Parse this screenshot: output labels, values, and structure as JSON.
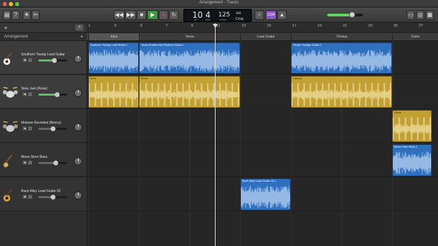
{
  "window": {
    "title": "Arrangement - Tracks"
  },
  "toolbar": {
    "lcd": {
      "bar": "10",
      "beat": "4",
      "bar_label": "bar",
      "beat_label": "beat",
      "tempo": "125",
      "tempo_label": "tempo",
      "sig": "4/4",
      "key": "Cmaj"
    },
    "count_in_label": "1234",
    "master_volume": 0.7
  },
  "arrangement_header": {
    "label": "Arrangement",
    "add": "+"
  },
  "ruler": {
    "bars": [
      "1",
      "3",
      "5",
      "7",
      "9",
      "11",
      "13",
      "15",
      "17",
      "19",
      "21",
      "23",
      "25",
      "27"
    ]
  },
  "sections": [
    {
      "label": "Intro"
    },
    {
      "label": "Verse"
    },
    {
      "label": "Lead Guitar"
    },
    {
      "label": "Chorus"
    },
    {
      "label": "Outro"
    }
  ],
  "tracks": [
    {
      "name": "Southern Twang Lead Guitar",
      "volume": 0.55
    },
    {
      "name": "Slow Jam (Rose)",
      "volume": 0.65
    },
    {
      "name": "Motown Revisited (Benny)",
      "volume": 0.5
    },
    {
      "name": "Blues Siren Bass",
      "volume": 0.6
    },
    {
      "name": "Back Alley Lead Guitar 02",
      "volume": 0.5
    }
  ],
  "regions": [
    {
      "label": "Southern Twang Lead Guitar.1"
    },
    {
      "label": "Texas Roadhouse Rhythm Guitar.2"
    },
    {
      "label": "Simple Garage Guitar.2"
    },
    {
      "label": "Intro"
    },
    {
      "label": "Verse"
    },
    {
      "label": "Chorus"
    },
    {
      "label": "Outro"
    },
    {
      "label": "Blues Siren Bass.1"
    },
    {
      "label": "Back Alley Lead Guitar 02.1"
    }
  ],
  "colors": {
    "audio": "#2f6fc0",
    "drummer": "#c3a033",
    "selection": "#3b7bd0"
  }
}
